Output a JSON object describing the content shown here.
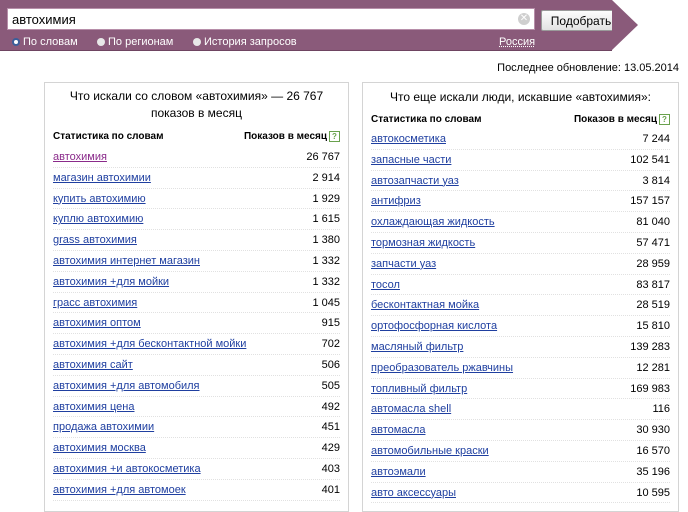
{
  "search": {
    "query": "автохимия",
    "submit_label": "Подобрать",
    "modes": [
      {
        "label": "По словам",
        "selected": true
      },
      {
        "label": "По регионам",
        "selected": false
      },
      {
        "label": "История запросов",
        "selected": false
      }
    ],
    "region": "Россия"
  },
  "updated": "Последнее обновление: 13.05.2014",
  "left_panel": {
    "title": "Что искали со словом «автохимия» — 26 767 показов в месяц",
    "col_keyword": "Статистика по словам",
    "col_count": "Показов в месяц",
    "rows": [
      {
        "keyword": "автохимия",
        "count": "26 767"
      },
      {
        "keyword": "магазин автохимии",
        "count": "2 914"
      },
      {
        "keyword": "купить автохимию",
        "count": "1 929"
      },
      {
        "keyword": "куплю автохимию",
        "count": "1 615"
      },
      {
        "keyword": "grass автохимия",
        "count": "1 380"
      },
      {
        "keyword": "автохимия интернет магазин",
        "count": "1 332"
      },
      {
        "keyword": "автохимия +для мойки",
        "count": "1 332"
      },
      {
        "keyword": "грасс автохимия",
        "count": "1 045"
      },
      {
        "keyword": "автохимия оптом",
        "count": "915"
      },
      {
        "keyword": "автохимия +для бесконтактной мойки",
        "count": "702"
      },
      {
        "keyword": "автохимия сайт",
        "count": "506"
      },
      {
        "keyword": "автохимия +для автомобиля",
        "count": "505"
      },
      {
        "keyword": "автохимия цена",
        "count": "492"
      },
      {
        "keyword": "продажа автохимии",
        "count": "451"
      },
      {
        "keyword": "автохимия москва",
        "count": "429"
      },
      {
        "keyword": "автохимия +и автокосметика",
        "count": "403"
      },
      {
        "keyword": "автохимия +для автомоек",
        "count": "401"
      }
    ]
  },
  "right_panel": {
    "title": "Что еще искали люди, искавшие «автохимия»:",
    "col_keyword": "Статистика по словам",
    "col_count": "Показов в месяц",
    "rows": [
      {
        "keyword": "автокосметика",
        "count": "7 244"
      },
      {
        "keyword": "запасные части",
        "count": "102 541"
      },
      {
        "keyword": "автозапчасти уаз",
        "count": "3 814"
      },
      {
        "keyword": "антифриз",
        "count": "157 157"
      },
      {
        "keyword": "охлаждающая жидкость",
        "count": "81 040"
      },
      {
        "keyword": "тормозная жидкость",
        "count": "57 471"
      },
      {
        "keyword": "запчасти уаз",
        "count": "28 959"
      },
      {
        "keyword": "тосол",
        "count": "83 817"
      },
      {
        "keyword": "бесконтактная мойка",
        "count": "28 519"
      },
      {
        "keyword": "ортофосфорная кислота",
        "count": "15 810"
      },
      {
        "keyword": "масляный фильтр",
        "count": "139 283"
      },
      {
        "keyword": "преобразователь ржавчины",
        "count": "12 281"
      },
      {
        "keyword": "топливный фильтр",
        "count": "169 983"
      },
      {
        "keyword": "автомасла shell",
        "count": "116"
      },
      {
        "keyword": "автомасла",
        "count": "30 930"
      },
      {
        "keyword": "автомобильные краски",
        "count": "16 570"
      },
      {
        "keyword": "автоэмали",
        "count": "35 196"
      },
      {
        "keyword": "авто аксессуары",
        "count": "10 595"
      }
    ]
  },
  "icons": {
    "clear": "clear-icon",
    "help": "help-icon"
  },
  "colors": {
    "band": "#8a5a7a",
    "link": "#1f3fa0",
    "visited_link": "#8a2a8a",
    "help": "#69a14d"
  }
}
